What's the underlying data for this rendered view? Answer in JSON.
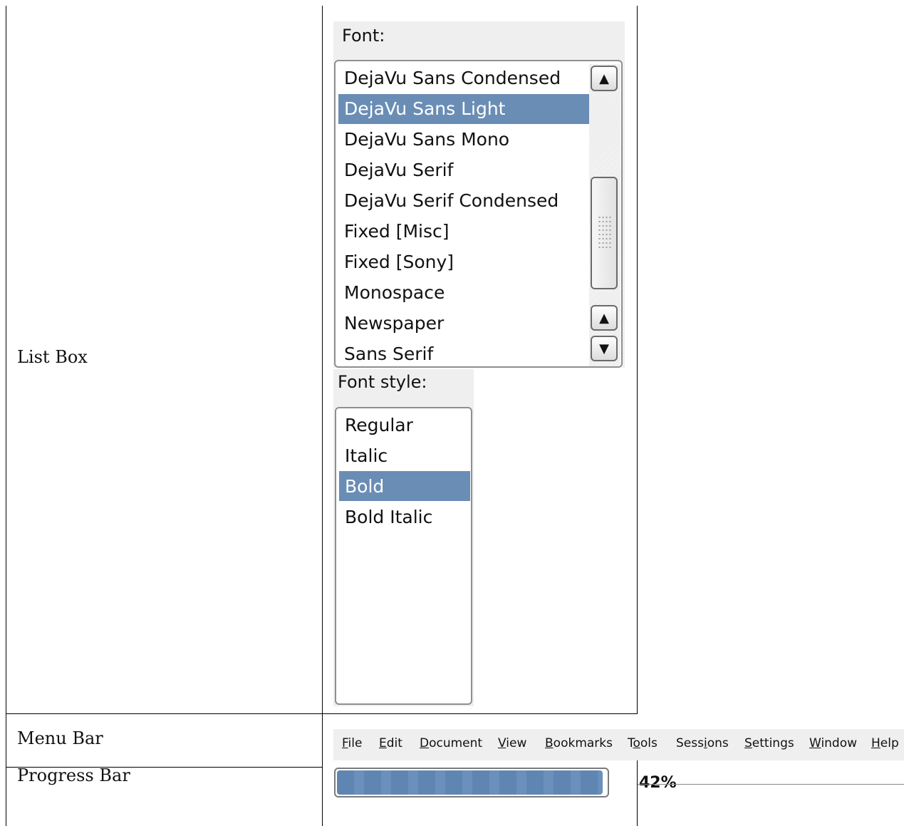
{
  "rows": {
    "list_box": "List Box",
    "menu_bar": "Menu Bar",
    "progress_bar": "Progress Bar"
  },
  "font_list": {
    "label": "Font:",
    "items": [
      "DejaVu Sans Condensed",
      "DejaVu Sans Light",
      "DejaVu Sans Mono",
      "DejaVu Serif",
      "DejaVu Serif Condensed",
      "Fixed [Misc]",
      "Fixed [Sony]",
      "Monospace",
      "Newspaper",
      "Sans Serif"
    ],
    "selected": "DejaVu Sans Light"
  },
  "style_list": {
    "label": "Font style:",
    "items": [
      "Regular",
      "Italic",
      "Bold",
      "Bold Italic"
    ],
    "selected": "Bold"
  },
  "menubar": {
    "items": [
      "File",
      "Edit",
      "Document",
      "View",
      "Bookmarks",
      "Tools",
      "Sessions",
      "Settings",
      "Window",
      "Help"
    ]
  },
  "progress": {
    "value_percent": 42,
    "label": "42%"
  },
  "colors": {
    "selection": "#6a8db5",
    "progress_fill": "#5f86b3",
    "panel_bg": "#efefef"
  },
  "icons": {
    "scroll_up": "up-arrow-icon",
    "scroll_down": "down-arrow-icon"
  }
}
